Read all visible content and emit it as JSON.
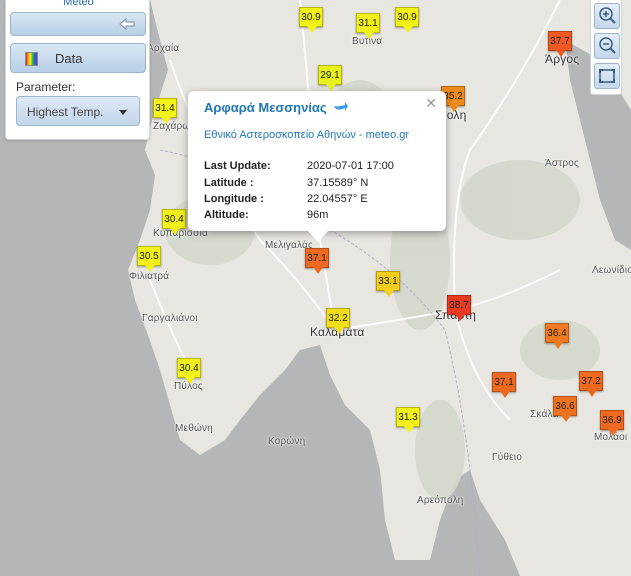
{
  "panel": {
    "brand": "Meteo",
    "data_label": "Data",
    "parameter_label": "Parameter:",
    "parameter_value": "Highest Temp."
  },
  "places": [
    {
      "name": "Αρχαία",
      "big": false
    },
    {
      "name": "Ζαχάρω",
      "big": false
    },
    {
      "name": "Βυτίνα",
      "big": false
    },
    {
      "name": "Άργος",
      "big": true
    },
    {
      "name": "Κυπαρισσία",
      "big": false
    },
    {
      "name": "Φιλιατρά",
      "big": false
    },
    {
      "name": "Μελιγαλάς",
      "big": false
    },
    {
      "name": "Τρίπολη",
      "big": true
    },
    {
      "name": "Άστρος",
      "big": false
    },
    {
      "name": "Λεωνίδιο",
      "big": false
    },
    {
      "name": "Γαργαλιάνοι",
      "big": false
    },
    {
      "name": "Καλαμάτα",
      "big": true
    },
    {
      "name": "Σπάρτη",
      "big": true
    },
    {
      "name": "Πύλος",
      "big": false
    },
    {
      "name": "Μεθώνη",
      "big": false
    },
    {
      "name": "Κορώνη",
      "big": false
    },
    {
      "name": "Σκάλα",
      "big": false
    },
    {
      "name": "Μολάοι",
      "big": false
    },
    {
      "name": "Γύθειο",
      "big": false
    },
    {
      "name": "Αρεόπολη",
      "big": false
    }
  ],
  "stations": [
    {
      "value": "30.9",
      "color": "#f2f21a"
    },
    {
      "value": "31.1",
      "color": "#f2f21a"
    },
    {
      "value": "30.9",
      "color": "#f2f21a"
    },
    {
      "value": "37.7",
      "color": "#ee5a22"
    },
    {
      "value": "29.1",
      "color": "#e8f21a"
    },
    {
      "value": "35.2",
      "color": "#f08a1c"
    },
    {
      "value": "31.4",
      "color": "#f2f21a"
    },
    {
      "value": "30.4",
      "color": "#f2f21a"
    },
    {
      "value": "30.5",
      "color": "#f2f21a"
    },
    {
      "value": "37.1",
      "color": "#ef6a20"
    },
    {
      "value": "33.1",
      "color": "#f2ce1a"
    },
    {
      "value": "38.7",
      "color": "#e63a22"
    },
    {
      "value": "32.2",
      "color": "#f2de1a"
    },
    {
      "value": "36.4",
      "color": "#f07a20"
    },
    {
      "value": "30.4",
      "color": "#f2f21a"
    },
    {
      "value": "37.1",
      "color": "#ef6a20"
    },
    {
      "value": "37.2",
      "color": "#ef6a20"
    },
    {
      "value": "36.6",
      "color": "#ef7220"
    },
    {
      "value": "31.3",
      "color": "#f2f21a"
    },
    {
      "value": "36.9",
      "color": "#ef6a20"
    }
  ],
  "popup": {
    "title": "Αρφαρά Μεσσηνίας",
    "source": "Εθνικό Αστεροσκοπείο Αθηνών - meteo.gr",
    "rows": [
      {
        "label": "Last Update:",
        "value": "2020-07-01 17:00"
      },
      {
        "label": "Latitude :",
        "value": "37.15589° N"
      },
      {
        "label": "Longitude :",
        "value": "22.04557° E"
      },
      {
        "label": "Altitude:",
        "value": "96m"
      }
    ]
  },
  "colors": {
    "land": "#e8e6e1",
    "sea": "#b5b6b7",
    "accent": "#1f77b4",
    "panel_button": "#c6d9ec"
  }
}
